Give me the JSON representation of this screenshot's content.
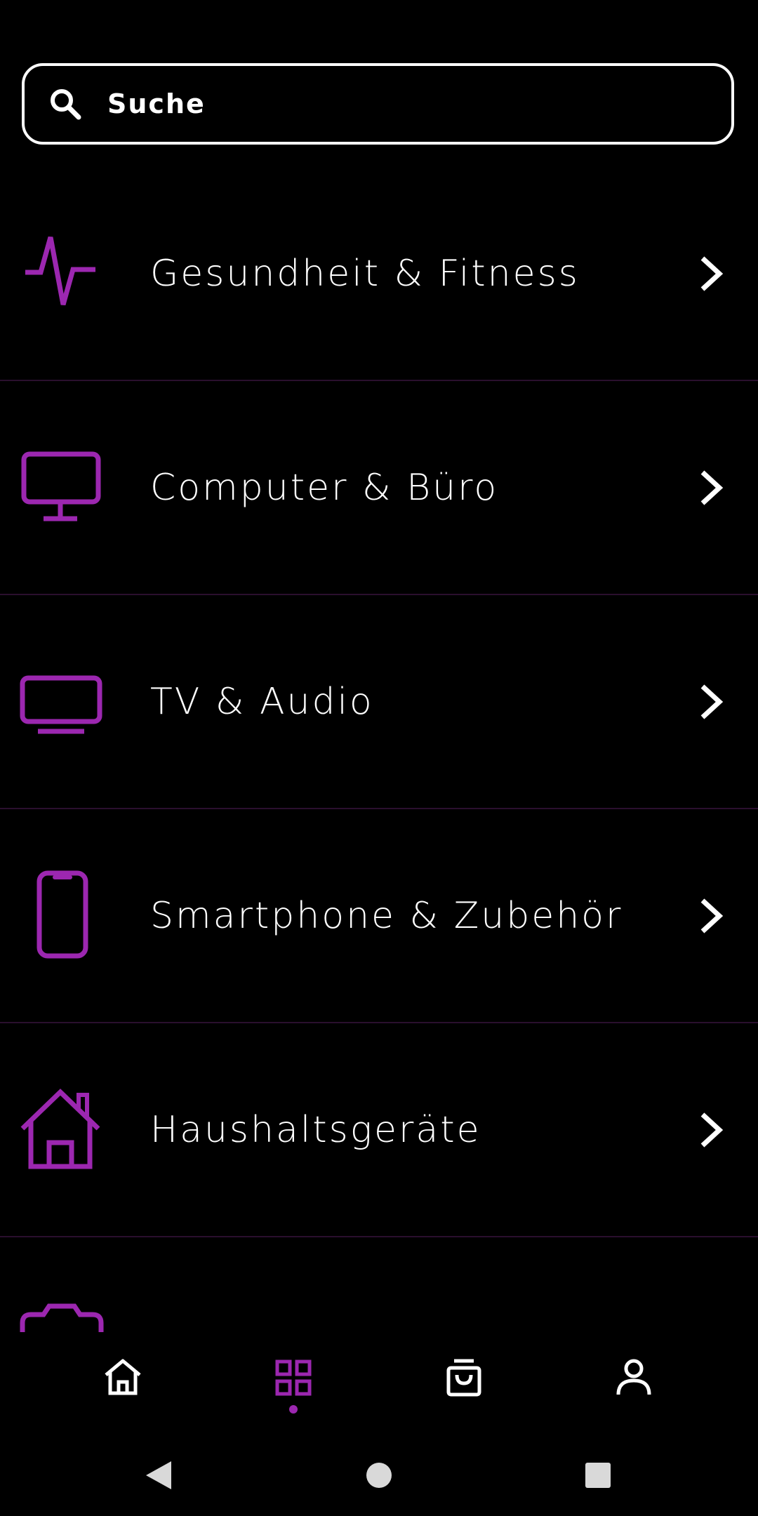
{
  "search": {
    "placeholder": "Suche"
  },
  "categories": [
    {
      "label": "Gesundheit & Fitness",
      "icon": "heartbeat-icon"
    },
    {
      "label": "Computer & Büro",
      "icon": "desktop-monitor-icon"
    },
    {
      "label": "TV & Audio",
      "icon": "tv-icon"
    },
    {
      "label": "Smartphone & Zubehör",
      "icon": "smartphone-icon"
    },
    {
      "label": "Haushaltsgeräte",
      "icon": "house-icon"
    },
    {
      "label": "",
      "icon": "camera-icon"
    }
  ],
  "bottom_nav": {
    "items": [
      {
        "icon": "home-icon",
        "active": false
      },
      {
        "icon": "categories-grid-icon",
        "active": true
      },
      {
        "icon": "shopping-bag-icon",
        "active": false
      },
      {
        "icon": "profile-icon",
        "active": false
      }
    ]
  },
  "system_nav": {
    "items": [
      "back-icon",
      "home-circle-icon",
      "recents-square-icon"
    ]
  },
  "colors": {
    "accent": "#9c27b0",
    "background": "#000000",
    "text": "#ffffff",
    "divider": "#2a0f2e",
    "system_nav": "#d9d9d9"
  }
}
